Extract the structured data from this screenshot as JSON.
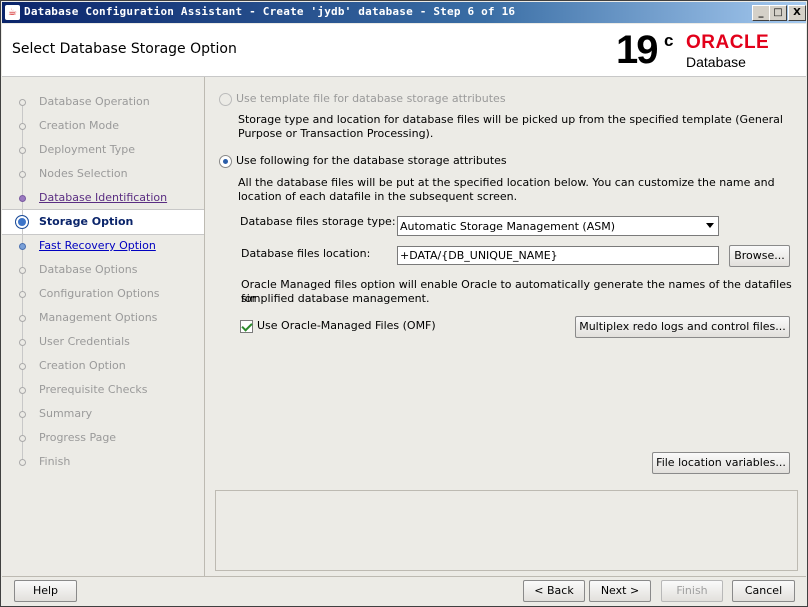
{
  "window": {
    "title": "Database Configuration Assistant - Create 'jydb' database - Step 6 of 16",
    "app_icon": "java-icon",
    "minimize": "_",
    "maximize": "□",
    "close": "X"
  },
  "header": {
    "page_title": "Select Database Storage Option",
    "logo_version": "19",
    "logo_suffix": "c",
    "logo_brand": "ORACLE",
    "logo_product": "Database",
    "brand_color": "#e2001a"
  },
  "sidebar": {
    "steps": [
      {
        "label": "Database Operation",
        "state": "pending"
      },
      {
        "label": "Creation Mode",
        "state": "pending"
      },
      {
        "label": "Deployment Type",
        "state": "pending"
      },
      {
        "label": "Nodes Selection",
        "state": "pending"
      },
      {
        "label": "Database Identification",
        "state": "done"
      },
      {
        "label": "Storage Option",
        "state": "current"
      },
      {
        "label": "Fast Recovery Option",
        "state": "next"
      },
      {
        "label": "Database Options",
        "state": "pending"
      },
      {
        "label": "Configuration Options",
        "state": "pending"
      },
      {
        "label": "Management Options",
        "state": "pending"
      },
      {
        "label": "User Credentials",
        "state": "pending"
      },
      {
        "label": "Creation Option",
        "state": "pending"
      },
      {
        "label": "Prerequisite Checks",
        "state": "pending"
      },
      {
        "label": "Summary",
        "state": "pending"
      },
      {
        "label": "Progress Page",
        "state": "pending"
      },
      {
        "label": "Finish",
        "state": "pending"
      }
    ]
  },
  "main": {
    "template_radio_label": "Use template file for database storage attributes",
    "template_desc_1": "Storage type and location for database files will be picked up from the specified template (General",
    "template_desc_2": "Purpose or Transaction Processing).",
    "following_radio_label": "Use following for the database storage attributes",
    "following_desc_1": "All the database files will be put at the specified location below. You can customize the name and",
    "following_desc_2": "location of each datafile in the subsequent screen.",
    "storage_type_label": "Database files storage type:",
    "storage_type_value": "Automatic Storage Management (ASM)",
    "location_label": "Database files location:",
    "location_value": "+DATA/{DB_UNIQUE_NAME}",
    "browse_button": "Browse...",
    "omf_desc_1": "Oracle Managed files option will enable Oracle to automatically generate the names of the datafiles for",
    "omf_desc_2": "simplified database management.",
    "omf_checkbox_label": "Use Oracle-Managed Files (OMF)",
    "omf_checked": true,
    "multiplex_button": "Multiplex redo logs and control files...",
    "file_location_button": "File location variables..."
  },
  "footer": {
    "help": "Help",
    "back": "< Back",
    "next": "Next >",
    "finish": "Finish",
    "cancel": "Cancel"
  }
}
